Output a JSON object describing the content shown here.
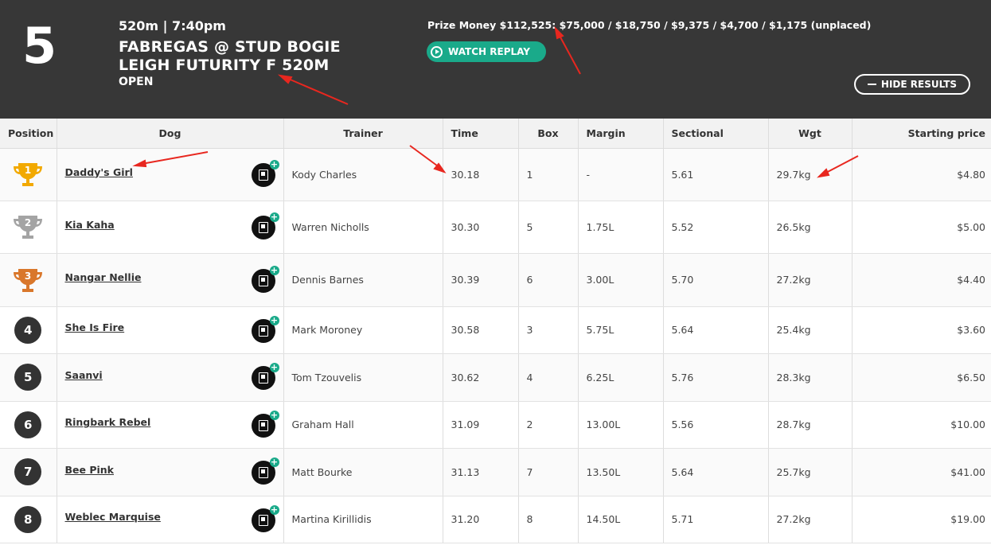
{
  "race": {
    "number": "5",
    "distance_time": "520m | 7:40pm",
    "title_line1": "FABREGAS @ STUD BOGIE",
    "title_line2": "LEIGH FUTURITY F 520M",
    "class": "OPEN",
    "prize_money": "Prize Money $112,525: $75,000 / $18,750 / $9,375 / $4,700 / $1,175 (unplaced)",
    "watch_replay_label": "WATCH REPLAY",
    "hide_results_label": "HIDE RESULTS"
  },
  "table": {
    "headers": {
      "position": "Position",
      "dog": "Dog",
      "trainer": "Trainer",
      "time": "Time",
      "box": "Box",
      "margin": "Margin",
      "sectional": "Sectional",
      "wgt": "Wgt",
      "sp": "Starting price"
    },
    "rows": [
      {
        "position": "1",
        "dog": "Daddy's Girl",
        "trainer": "Kody Charles",
        "time": "30.18",
        "box": "1",
        "margin": "-",
        "sectional": "5.61",
        "wgt": "29.7kg",
        "sp": "$4.80"
      },
      {
        "position": "2",
        "dog": "Kia Kaha",
        "trainer": "Warren Nicholls",
        "time": "30.30",
        "box": "5",
        "margin": "1.75L",
        "sectional": "5.52",
        "wgt": "26.5kg",
        "sp": "$5.00"
      },
      {
        "position": "3",
        "dog": "Nangar Nellie",
        "trainer": "Dennis Barnes",
        "time": "30.39",
        "box": "6",
        "margin": "3.00L",
        "sectional": "5.70",
        "wgt": "27.2kg",
        "sp": "$4.40"
      },
      {
        "position": "4",
        "dog": "She Is Fire",
        "trainer": "Mark Moroney",
        "time": "30.58",
        "box": "3",
        "margin": "5.75L",
        "sectional": "5.64",
        "wgt": "25.4kg",
        "sp": "$3.60"
      },
      {
        "position": "5",
        "dog": "Saanvi",
        "trainer": "Tom Tzouvelis",
        "time": "30.62",
        "box": "4",
        "margin": "6.25L",
        "sectional": "5.76",
        "wgt": "28.3kg",
        "sp": "$6.50"
      },
      {
        "position": "6",
        "dog": "Ringbark Rebel",
        "trainer": "Graham Hall",
        "time": "31.09",
        "box": "2",
        "margin": "13.00L",
        "sectional": "5.56",
        "wgt": "28.7kg",
        "sp": "$10.00"
      },
      {
        "position": "7",
        "dog": "Bee Pink",
        "trainer": "Matt Bourke",
        "time": "31.13",
        "box": "7",
        "margin": "13.50L",
        "sectional": "5.64",
        "wgt": "25.7kg",
        "sp": "$41.00"
      },
      {
        "position": "8",
        "dog": "Weblec Marquise",
        "trainer": "Martina Kirillidis",
        "time": "31.20",
        "box": "8",
        "margin": "14.50L",
        "sectional": "5.71",
        "wgt": "27.2kg",
        "sp": "$19.00"
      }
    ]
  },
  "colors": {
    "header_bg": "#373737",
    "accent_green": "#1aaa8a",
    "gold": "#f2a900",
    "silver": "#a4a4a4",
    "bronze": "#d9772b",
    "annotation_red": "#e8271f"
  },
  "icons": {
    "play": "play-icon",
    "minus": "minus-icon",
    "trophy": "trophy-icon",
    "form_guide": "form-guide-icon",
    "plus": "plus-icon"
  }
}
